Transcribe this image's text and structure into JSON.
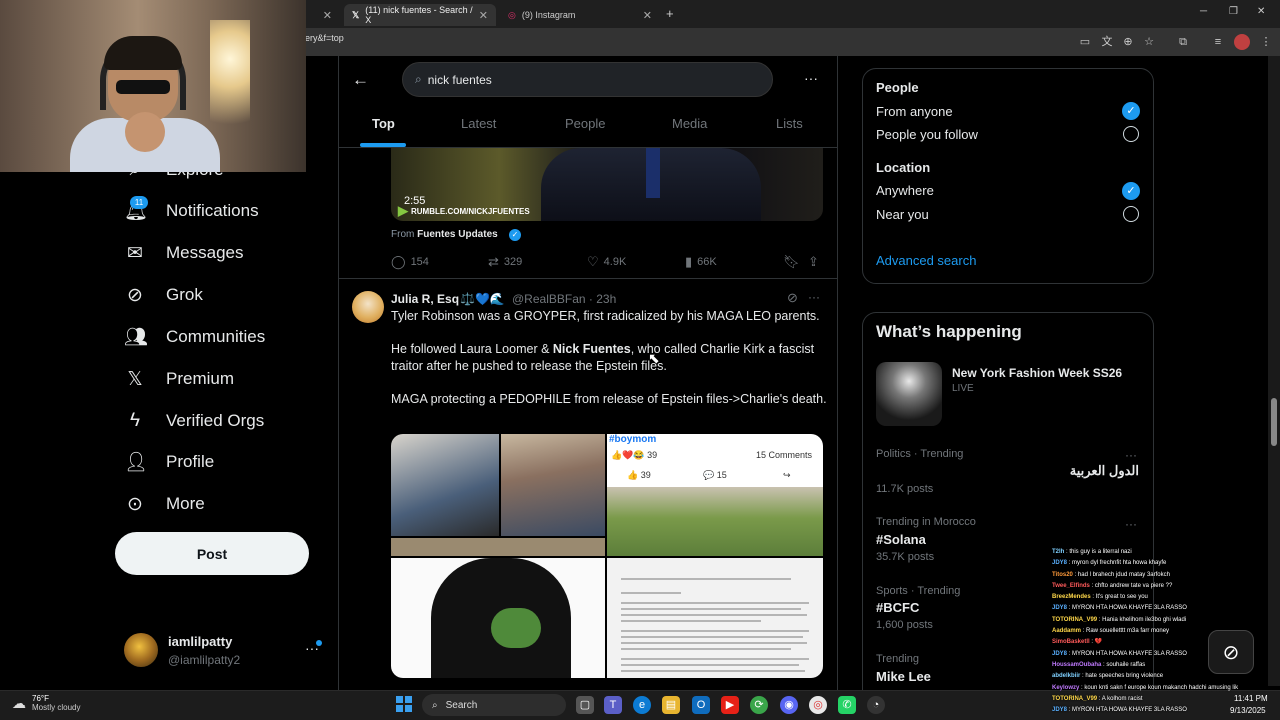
{
  "browser": {
    "tabs": [
      {
        "label": "(11) nick fuentes - Search / X",
        "active": true
      },
      {
        "label": "(9) Instagram",
        "active": false
      }
    ],
    "url_fragment": "ery&f=top"
  },
  "nav": {
    "items": [
      {
        "label": "Explore",
        "icon": "magnifier-icon"
      },
      {
        "label": "Notifications",
        "icon": "bell-icon"
      },
      {
        "label": "Messages",
        "icon": "envelope-icon"
      },
      {
        "label": "Grok",
        "icon": "grok-icon"
      },
      {
        "label": "Communities",
        "icon": "people-icon"
      },
      {
        "label": "Premium",
        "icon": "x-logo-icon"
      },
      {
        "label": "Verified Orgs",
        "icon": "lightning-icon"
      },
      {
        "label": "Profile",
        "icon": "person-icon"
      },
      {
        "label": "More",
        "icon": "more-circle-icon"
      }
    ],
    "notification_count": "11",
    "post_label": "Post",
    "account": {
      "name": "iamlilpatty",
      "handle": "@iamlilpatty2"
    }
  },
  "search": {
    "query": "nick fuentes",
    "tabs": [
      "Top",
      "Latest",
      "People",
      "Media",
      "Lists"
    ],
    "active_tab": "Top"
  },
  "prev_tweet": {
    "video_duration": "2:55",
    "video_watermark": "RUMBLE.COM/NICKJFUENTES",
    "from_prefix": "From",
    "from_name": "Fuentes Updates",
    "replies": "154",
    "retweets": "329",
    "likes": "4.9K",
    "views": "66K"
  },
  "tweet": {
    "author_name": "Julia R, Esq",
    "author_emoji": "⚖️💙🌊",
    "handle": "@RealBBFan",
    "time": "23h",
    "para1": "Tyler Robinson was a GROYPER, first radicalized by his MAGA LEO parents.",
    "para2_a": "He followed Laura Loomer & ",
    "para2_bold": "Nick Fuentes",
    "para2_b": ", who called Charlie Kirk a fascist traitor after he pushed to release the Epstein files.",
    "para3": "MAGA protecting a PEDOPHILE from release of Epstein files->Charlie's death.",
    "media": {
      "fb_hashtag": "#boymom",
      "fb_reactions": "39",
      "fb_comments": "15 Comments",
      "fb_likes": "39",
      "fb_comment_count": "15"
    }
  },
  "filters": {
    "people_heading": "People",
    "people_options": [
      {
        "label": "From anyone",
        "selected": true
      },
      {
        "label": "People you follow",
        "selected": false
      }
    ],
    "location_heading": "Location",
    "location_options": [
      {
        "label": "Anywhere",
        "selected": true
      },
      {
        "label": "Near you",
        "selected": false
      }
    ],
    "advanced_label": "Advanced search"
  },
  "happening": {
    "title": "What’s happening",
    "event": {
      "title": "New York Fashion Week SS26",
      "status": "LIVE"
    },
    "trends": [
      {
        "meta": "Politics · Trending",
        "name": "الدول العربية",
        "count": "11.7K posts"
      },
      {
        "meta": "Trending in Morocco",
        "name": "#Solana",
        "count": "35.7K posts"
      },
      {
        "meta": "Sports · Trending",
        "name": "#BCFC",
        "count": "1,600 posts"
      },
      {
        "meta": "Trending",
        "name": "Mike Lee",
        "count": ""
      }
    ]
  },
  "chat": [
    {
      "user": "T2lh",
      "color": "#7fd0ff",
      "msg": "this guy is a literral nazi"
    },
    {
      "user": "JDY8",
      "color": "#5ab0ff",
      "msg": "myron dyl frechnfit hta howa khayfe"
    },
    {
      "user": "Titos20",
      "color": "#ff9a3a",
      "msg": "had l brahech jdud matay 3arfokch"
    },
    {
      "user": "Twee_Elfinds",
      "color": "#ff5a5a",
      "msg": "chfto andrew tate va piere ??"
    },
    {
      "user": "BreezMendes",
      "color": "#ffd84a",
      "msg": "It's great to see you"
    },
    {
      "user": "JDY8",
      "color": "#5ab0ff",
      "msg": "MYRON HTA HOWA KHAYFE 3LA RASSO"
    },
    {
      "user": "TOTORINA_V99",
      "color": "#ffd84a",
      "msg": "Hania khelihom ile3bo ghi wladi"
    },
    {
      "user": "Aaddamm",
      "color": "#ffd84a",
      "msg": "Raw souelletttt m3a farr money"
    },
    {
      "user": "SimoBasketll",
      "color": "#ff5a5a",
      "msg": "💔"
    },
    {
      "user": "JDY8",
      "color": "#5ab0ff",
      "msg": "MYRON HTA HOWA KHAYFE 3LA RASSO"
    },
    {
      "user": "HoussamOubaha",
      "color": "#c07aff",
      "msg": "souhaile raffas"
    },
    {
      "user": "abdelkbiir",
      "color": "#7fd0ff",
      "msg": "hate speeches bring violence"
    },
    {
      "user": "Keylowzy",
      "color": "#c07aff",
      "msg": "koun knti sakn f europe koun makanch hadchi amusing lik"
    },
    {
      "user": "TOTORINA_V99",
      "color": "#ffd84a",
      "msg": "A kolhom racist"
    },
    {
      "user": "JDY8",
      "color": "#5ab0ff",
      "msg": "MYRON HTA HOWA KHAYFE 3LA RASSO"
    }
  ],
  "taskbar": {
    "temperature": "76°F",
    "condition": "Mostly cloudy",
    "search_label": "Search",
    "time": "11:41 PM",
    "date": "9/13/2025"
  }
}
